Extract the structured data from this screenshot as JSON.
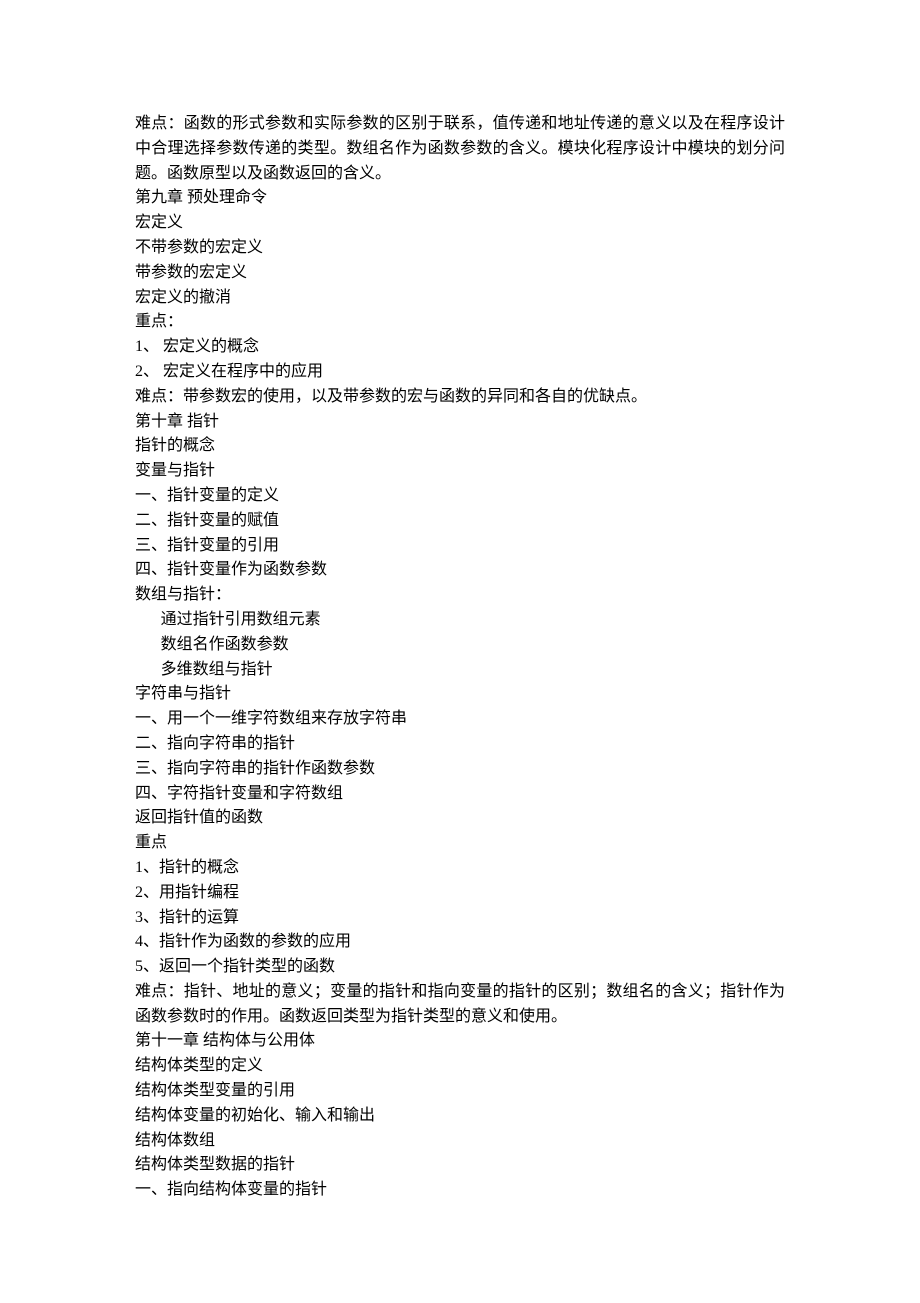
{
  "lines": [
    {
      "text": "难点：函数的形式参数和实际参数的区别于联系，值传递和地址传递的意义以及在程序设计中合理选择参数传递的类型。数组名作为函数参数的含义。模块化程序设计中模块的划分问题。函数原型以及函数返回的含义。"
    },
    {
      "text": "第九章 预处理命令"
    },
    {
      "text": "宏定义"
    },
    {
      "text": "不带参数的宏定义"
    },
    {
      "text": "带参数的宏定义"
    },
    {
      "text": "宏定义的撤消"
    },
    {
      "text": "重点："
    },
    {
      "text": "1、 宏定义的概念"
    },
    {
      "text": "2、 宏定义在程序中的应用"
    },
    {
      "text": "难点：带参数宏的使用，以及带参数的宏与函数的异同和各自的优缺点。"
    },
    {
      "text": "第十章 指针"
    },
    {
      "text": "指针的概念"
    },
    {
      "text": "变量与指针"
    },
    {
      "text": "一、指针变量的定义"
    },
    {
      "text": "二、指针变量的赋值"
    },
    {
      "text": "三、指针变量的引用"
    },
    {
      "text": "四、指针变量作为函数参数"
    },
    {
      "text": "数组与指针："
    },
    {
      "text": "通过指针引用数组元素",
      "indent": 1
    },
    {
      "text": "数组名作函数参数",
      "indent": 1
    },
    {
      "text": "多维数组与指针",
      "indent": 1
    },
    {
      "text": "字符串与指针"
    },
    {
      "text": "一、用一个一维字符数组来存放字符串"
    },
    {
      "text": "二、指向字符串的指针"
    },
    {
      "text": "三、指向字符串的指针作函数参数"
    },
    {
      "text": "四、字符指针变量和字符数组"
    },
    {
      "text": "返回指针值的函数"
    },
    {
      "text": "重点"
    },
    {
      "text": "1、指针的概念"
    },
    {
      "text": "2、用指针编程"
    },
    {
      "text": "3、指针的运算"
    },
    {
      "text": "4、指针作为函数的参数的应用"
    },
    {
      "text": "5、返回一个指针类型的函数"
    },
    {
      "text": "难点：指针、地址的意义；变量的指针和指向变量的指针的区别；数组名的含义；指针作为函数参数时的作用。函数返回类型为指针类型的意义和使用。"
    },
    {
      "text": "第十一章 结构体与公用体"
    },
    {
      "text": "结构体类型的定义"
    },
    {
      "text": "结构体类型变量的引用"
    },
    {
      "text": "结构体变量的初始化、输入和输出"
    },
    {
      "text": "结构体数组"
    },
    {
      "text": "结构体类型数据的指针"
    },
    {
      "text": "一、指向结构体变量的指针"
    }
  ]
}
